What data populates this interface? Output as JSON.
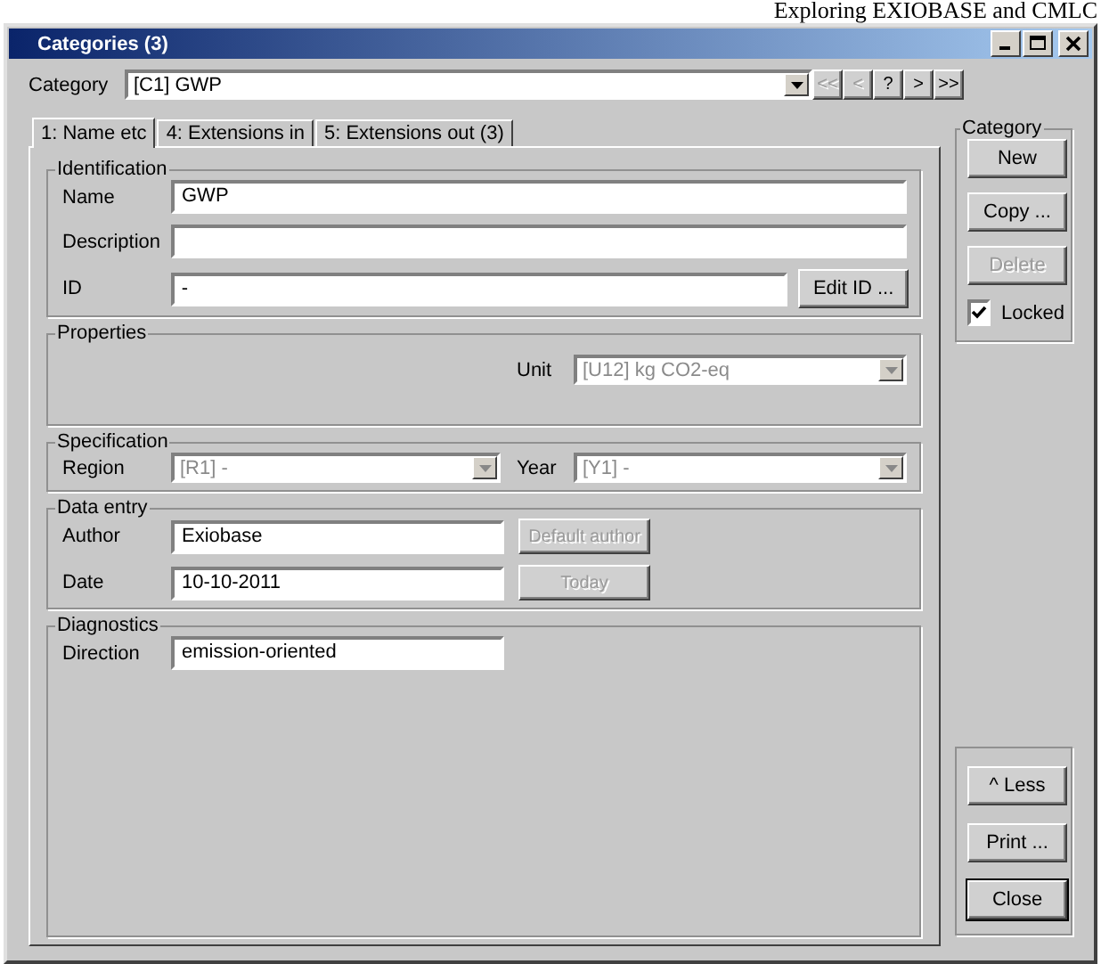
{
  "page_header": "Exploring EXIOBASE and CMLC",
  "window": {
    "title": "Categories (3)"
  },
  "category_selector": {
    "label": "Category",
    "value": "[C1] GWP"
  },
  "nav_buttons": [
    {
      "label": "<<",
      "disabled": true
    },
    {
      "label": "<",
      "disabled": true
    },
    {
      "label": "?",
      "disabled": false
    },
    {
      "label": ">",
      "disabled": false
    },
    {
      "label": ">>",
      "disabled": false
    }
  ],
  "tabs": [
    {
      "label": "1: Name etc",
      "selected": true
    },
    {
      "label": "4: Extensions in",
      "selected": false
    },
    {
      "label": "5: Extensions out (3)",
      "selected": false
    }
  ],
  "identification": {
    "title": "Identification",
    "name": {
      "label": "Name",
      "value": "GWP"
    },
    "description": {
      "label": "Description"
    },
    "id": {
      "label": "ID",
      "value": "-",
      "button": "Edit ID ..."
    }
  },
  "properties": {
    "title": "Properties",
    "unit": {
      "label": "Unit",
      "value": "[U12] kg CO2-eq",
      "disabled": true
    }
  },
  "specification": {
    "title": "Specification",
    "region": {
      "label": "Region",
      "value": "[R1] -",
      "disabled": true
    },
    "year": {
      "label": "Year",
      "value": "[Y1] -",
      "disabled": true
    }
  },
  "data_entry": {
    "title": "Data entry",
    "author": {
      "label": "Author",
      "value": "Exiobase",
      "button": "Default author",
      "button_disabled": true
    },
    "date": {
      "label": "Date",
      "value": "10-10-2011",
      "button": "Today",
      "button_disabled": true
    }
  },
  "diagnostics": {
    "title": "Diagnostics",
    "direction": {
      "label": "Direction",
      "value": "emission-oriented"
    }
  },
  "category_panel": {
    "title": "Category",
    "buttons": [
      {
        "label": "New",
        "disabled": false
      },
      {
        "label": "Copy ...",
        "disabled": false
      },
      {
        "label": "Delete",
        "disabled": true
      }
    ],
    "locked": {
      "label": "Locked",
      "checked": true
    }
  },
  "bottom_buttons": [
    {
      "label": "^ Less",
      "default": false
    },
    {
      "label": "Print ...",
      "default": false
    },
    {
      "label": "Close",
      "default": true
    }
  ]
}
